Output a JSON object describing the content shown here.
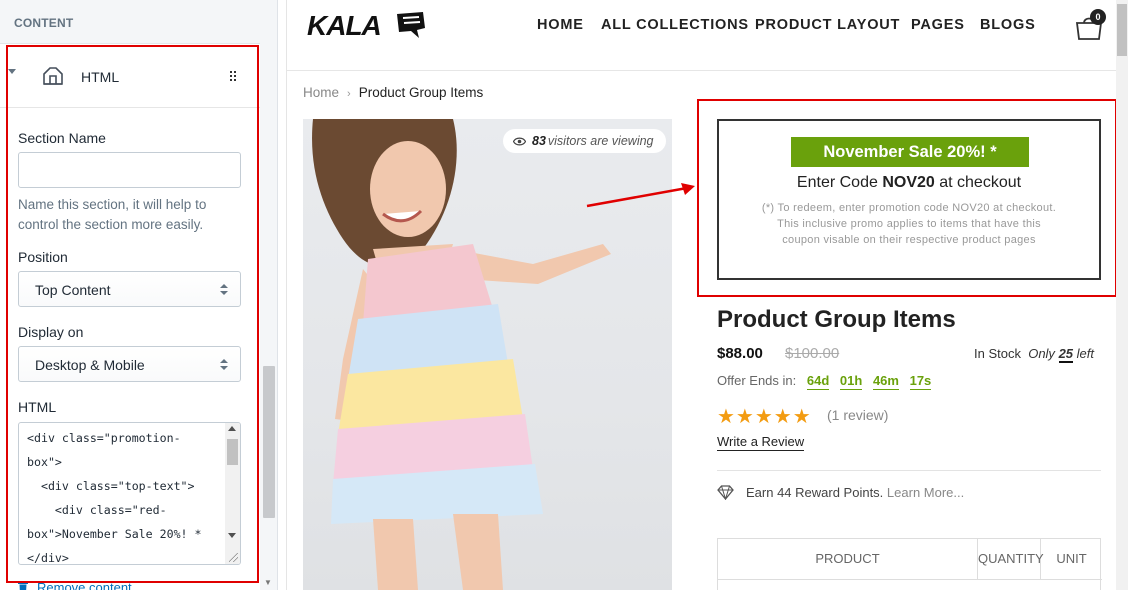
{
  "editor": {
    "header": "CONTENT",
    "section_title": "HTML",
    "section_name_label": "Section Name",
    "section_name_value": "",
    "section_name_help": "Name this section, it will help to control the section more easily.",
    "position_label": "Position",
    "position_value": "Top Content",
    "display_label": "Display on",
    "display_value": "Desktop & Mobile",
    "html_label": "HTML",
    "html_code_lines": [
      "<div class=\"promotion-",
      "box\">",
      "  <div class=\"top-text\">",
      "    <div class=\"red-",
      "box\">November Sale 20%! *",
      "</div>"
    ],
    "remove_label": "Remove content"
  },
  "store": {
    "logo_text": "KALA",
    "nav": [
      "HOME",
      "ALL COLLECTIONS",
      "PRODUCT LAYOUT",
      "PAGES",
      "BLOGS"
    ],
    "cart_count": "0",
    "breadcrumb": {
      "home": "Home",
      "current": "Product Group Items"
    },
    "visitors": {
      "count": "83",
      "text": "visitors are viewing"
    },
    "promo": {
      "badge": "November Sale 20%! *",
      "line_prefix": "Enter Code ",
      "code": "NOV20",
      "line_suffix": " at checkout",
      "note": "(*) To redeem, enter promotion code NOV20 at checkout. This inclusive promo applies to items that have this coupon visable on their respective product pages"
    },
    "product": {
      "title": "Product Group Items",
      "price": "$88.00",
      "compare_price": "$100.00",
      "stock_prefix": "In Stock",
      "stock_only": "Only",
      "stock_count": "25",
      "stock_suffix": "left",
      "offer_label": "Offer Ends in:",
      "timer": [
        "64d",
        "01h",
        "46m",
        "17s"
      ],
      "rating": 5,
      "stars": "★★★★★",
      "reviews": "(1 review)",
      "write_review": "Write a Review",
      "reward": "Earn 44 Reward Points.",
      "learn_more": "Learn More..."
    },
    "table_headers": [
      "PRODUCT",
      "QUANTITY",
      "UNIT"
    ]
  },
  "colors": {
    "highlight_border": "#e00000",
    "promo_green": "#6aa10c",
    "star": "#f39c12",
    "link_blue": "#006fbb"
  }
}
